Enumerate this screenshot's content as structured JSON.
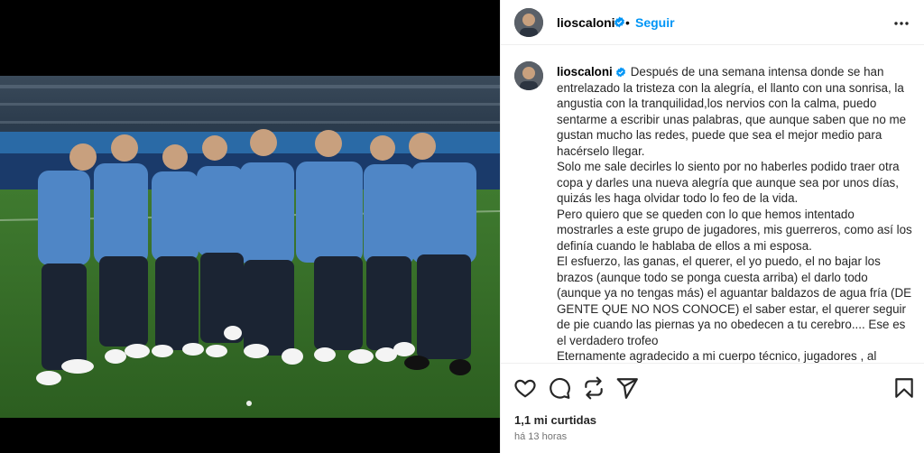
{
  "header": {
    "username": "lioscaloni",
    "separator": "•",
    "follow_label": "Seguir"
  },
  "caption": {
    "username": "lioscaloni",
    "paragraphs": [
      "Después de una semana intensa donde se han entrelazado la tristeza con la alegría, el llanto con una sonrisa, la angustia con la tranquilidad,los nervios con la calma, puedo sentarme a escribir unas palabras, que aunque saben que no me gustan mucho las redes, puede que sea el mejor medio para hacérselo llegar.",
      "Solo me sale decirles lo siento por no haberles podido traer otra copa y darles una nueva alegría que aunque sea por unos días, quizás les haga olvidar todo lo feo de la vida.",
      "Pero quiero que se queden con lo que hemos intentado mostrarles a este grupo de jugadores, mis guerreros, como así los definía cuando le hablaba de ellos a mi esposa.",
      "El esfuerzo, las ganas, el querer, el yo puedo, el no bajar los brazos (aunque todo se ponga cuesta arriba) el darlo todo (aunque ya no tengas más) el aguantar baldazos de agua fría (DE GENTE QUE NO NOS CONOCE) el saber estar, el querer seguir de pie cuando las piernas ya no obedecen a tu cerebro.... Ese es el verdadero trofeo",
      "Eternamente agradecido a mi cuerpo técnico, jugadores , al personal de AFA , aquellos que de forma silenciosa trabajan para"
    ]
  },
  "footer": {
    "likes": "1,1 mi curtidas",
    "time": "há 13 horas"
  },
  "icons": [
    "heart-icon",
    "comment-icon",
    "share-icon",
    "send-icon",
    "bookmark-icon",
    "more-options-icon",
    "verified-badge-icon"
  ],
  "colors": {
    "accent": "#0095f6",
    "verified": "#0095f6",
    "text": "#262626",
    "muted": "#737373"
  }
}
